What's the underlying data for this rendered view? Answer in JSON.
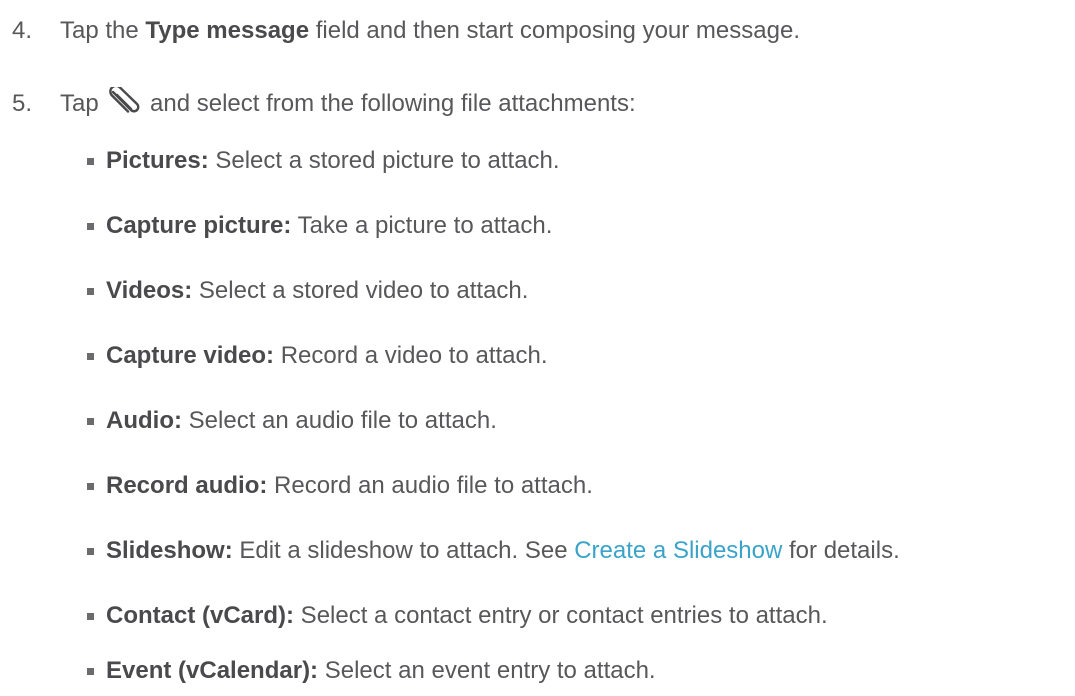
{
  "steps": [
    {
      "number": "4.",
      "pre": "Tap the ",
      "bold": "Type message",
      "post": " field and then start composing your message."
    },
    {
      "number": "5.",
      "pre": "Tap ",
      "icon": "paperclip-icon",
      "post": " and select from the following file attachments:"
    }
  ],
  "attachments": [
    {
      "term": "Pictures:",
      "desc": " Select a stored picture to attach."
    },
    {
      "term": "Capture picture:",
      "desc": " Take a picture to attach."
    },
    {
      "term": "Videos:",
      "desc": " Select a stored video to attach."
    },
    {
      "term": "Capture video:",
      "desc": " Record a video to attach."
    },
    {
      "term": "Audio:",
      "desc": " Select an audio file to attach."
    },
    {
      "term": "Record audio:",
      "desc": " Record an audio file to attach."
    },
    {
      "term": "Slideshow:",
      "desc": " Edit a slideshow to attach. See ",
      "link": "Create a Slideshow",
      "after": " for details."
    },
    {
      "term": "Contact (vCard):",
      "desc": " Select a contact entry or contact entries to attach."
    },
    {
      "term": "Event (vCalendar):",
      "desc": " Select an event entry to attach."
    }
  ],
  "colors": {
    "text": "#58585a",
    "link": "#3aa3c9",
    "bullet": "#6b6b6d"
  }
}
